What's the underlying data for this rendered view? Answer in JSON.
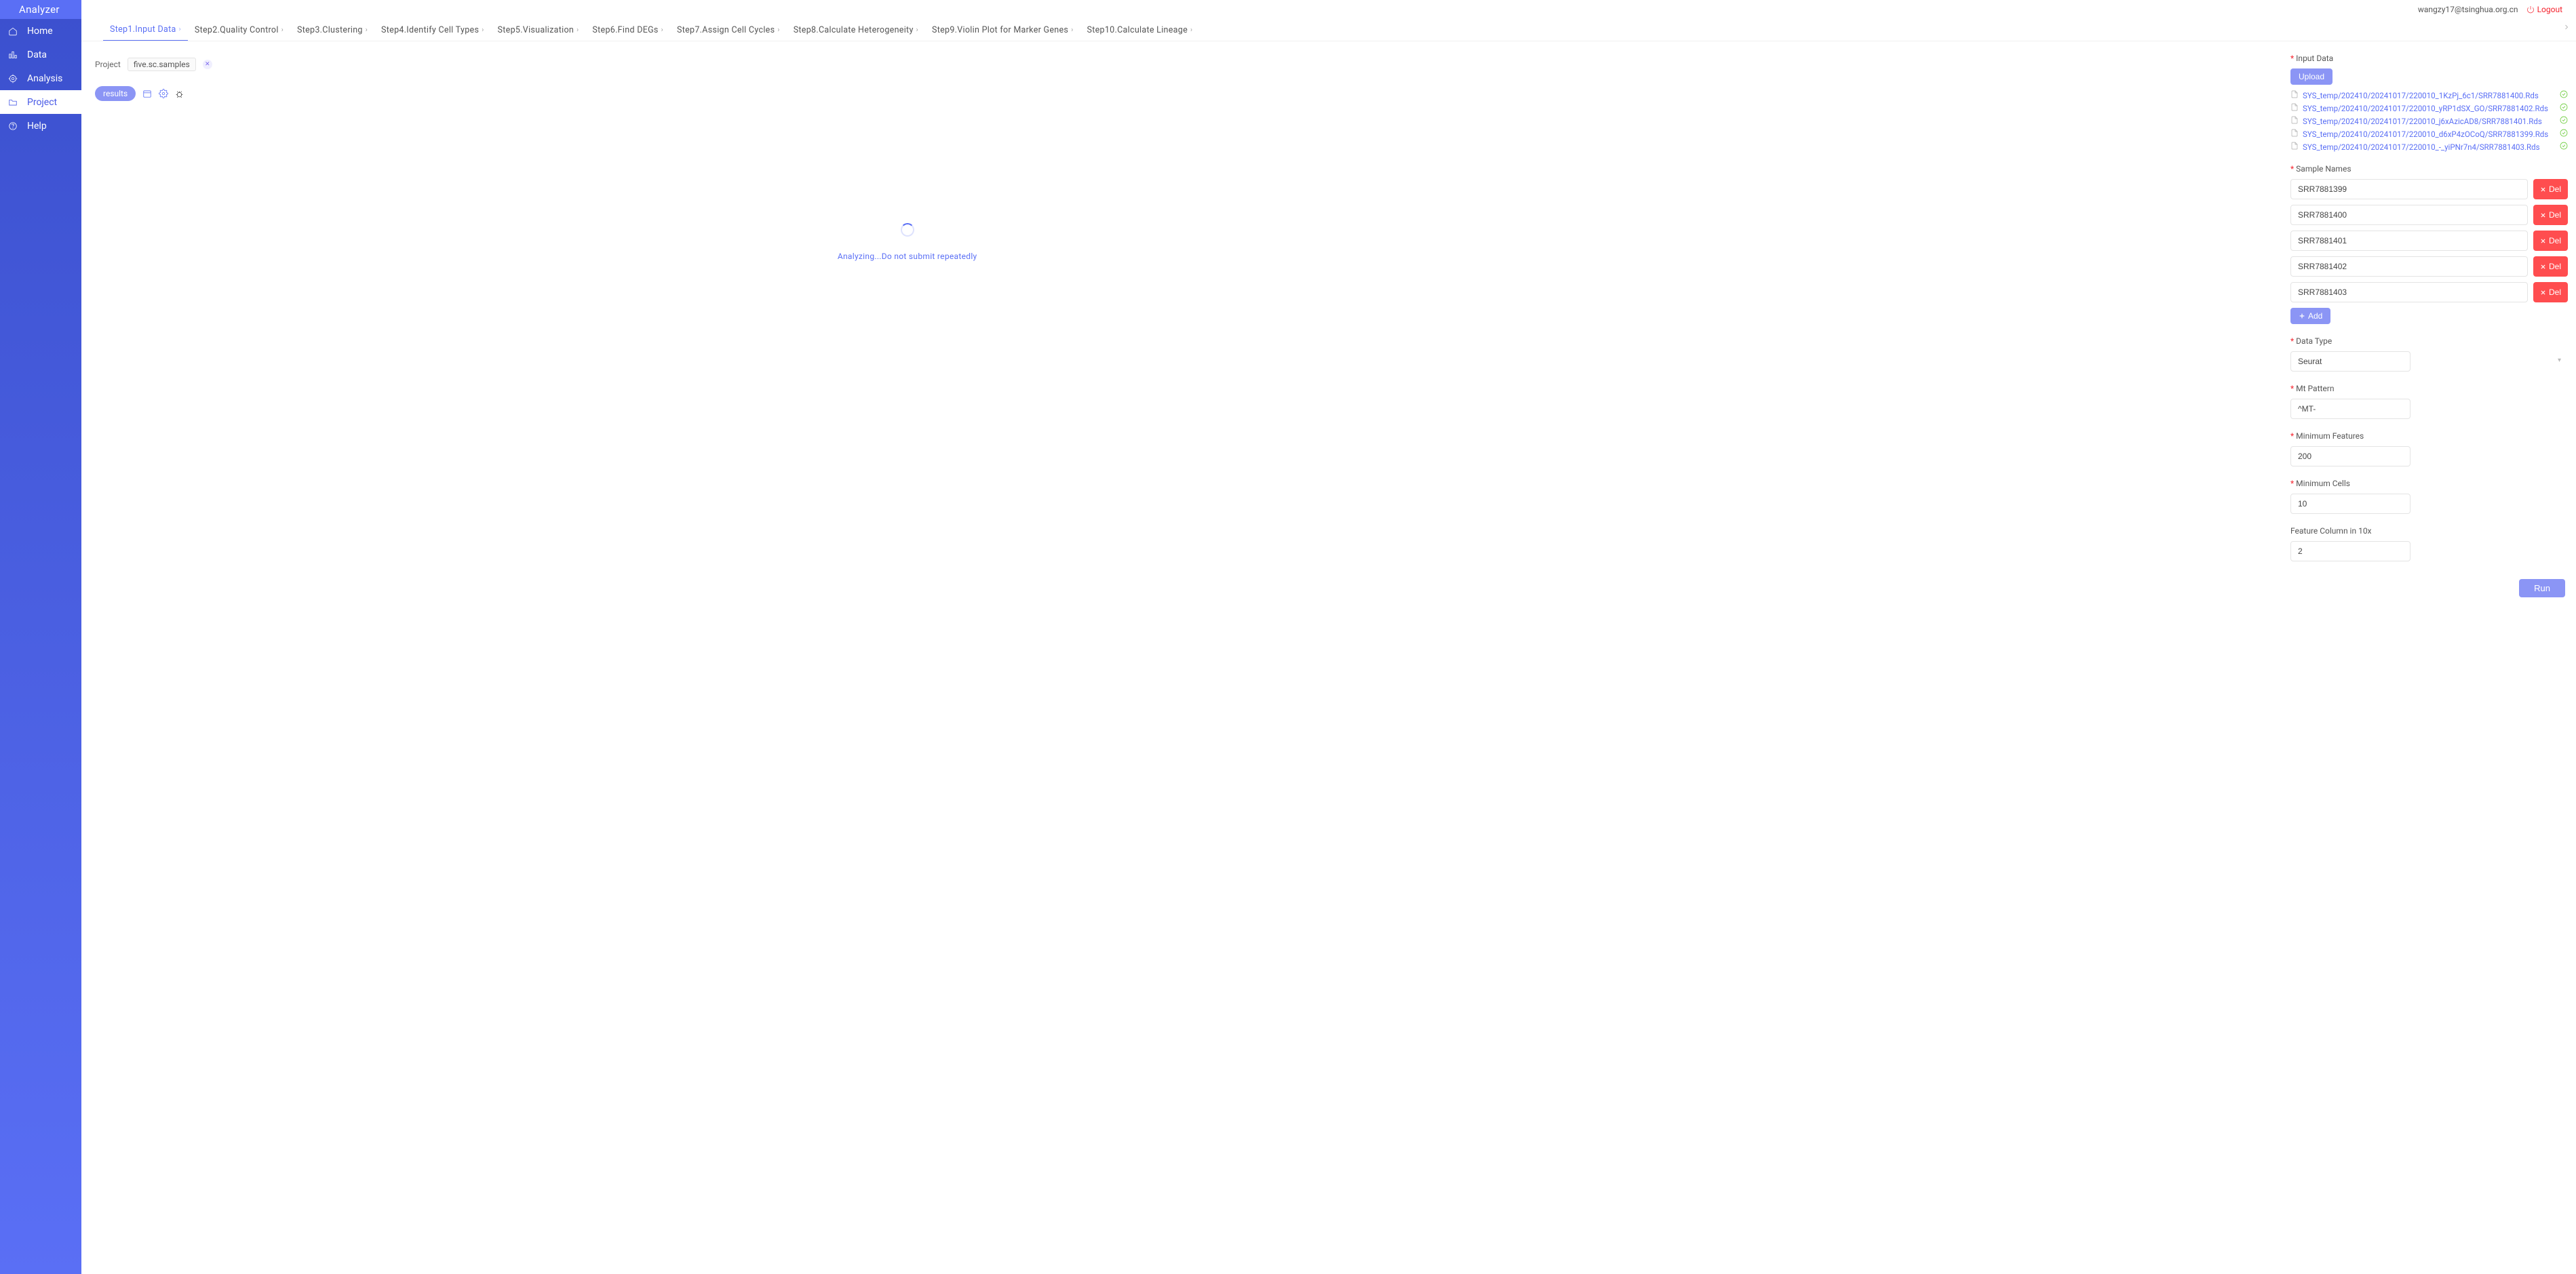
{
  "brand": "Analyzer",
  "header": {
    "user_email": "wangzy17@tsinghua.org.cn",
    "logout_label": "Logout"
  },
  "sidebar": {
    "items": [
      {
        "key": "home",
        "label": "Home"
      },
      {
        "key": "data",
        "label": "Data"
      },
      {
        "key": "analysis",
        "label": "Analysis"
      },
      {
        "key": "project",
        "label": "Project"
      },
      {
        "key": "help",
        "label": "Help"
      }
    ],
    "active_key": "project"
  },
  "tabs": {
    "items": [
      "Step1.Input Data",
      "Step2.Quality Control",
      "Step3.Clustering",
      "Step4.Identify Cell Types",
      "Step5.Visualization",
      "Step6.Find DEGs",
      "Step7.Assign Cell Cycles",
      "Step8.Calculate Heterogeneity",
      "Step9.Violin Plot for Marker Genes",
      "Step10.Calculate Lineage"
    ],
    "active_index": 0
  },
  "center": {
    "project_label": "Project",
    "project_name": "five.sc.samples",
    "results_label": "results",
    "analyzing_text": "Analyzing...Do not submit repeatedly"
  },
  "form": {
    "input_data": {
      "label": "Input Data",
      "upload_label": "Upload",
      "files": [
        "SYS_temp/202410/20241017/220010_1KzPj_6c1/SRR7881400.Rds",
        "SYS_temp/202410/20241017/220010_yRP1dSX_GO/SRR7881402.Rds",
        "SYS_temp/202410/20241017/220010_j6xAzicAD8/SRR7881401.Rds",
        "SYS_temp/202410/20241017/220010_d6xP4zOCoQ/SRR7881399.Rds",
        "SYS_temp/202410/20241017/220010_-_yiPNr7n4/SRR7881403.Rds"
      ]
    },
    "sample_names": {
      "label": "Sample Names",
      "values": [
        "SRR7881399",
        "SRR7881400",
        "SRR7881401",
        "SRR7881402",
        "SRR7881403"
      ],
      "del_label": "Del",
      "add_label": "Add"
    },
    "data_type": {
      "label": "Data Type",
      "value": "Seurat"
    },
    "mt_pattern": {
      "label": "Mt Pattern",
      "value": "^MT-"
    },
    "min_features": {
      "label": "Minimum Features",
      "value": "200"
    },
    "min_cells": {
      "label": "Minimum Cells",
      "value": "10"
    },
    "feature_col": {
      "label": "Feature Column in 10x",
      "value": "2"
    },
    "run_label": "Run"
  }
}
